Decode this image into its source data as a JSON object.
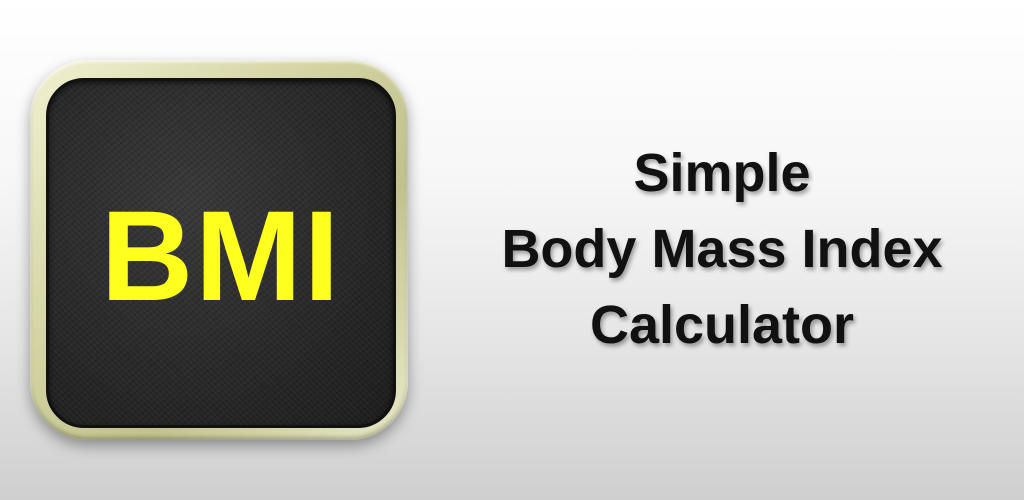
{
  "icon": {
    "label": "BMI",
    "label_color": "#ffff1e",
    "background_color": "#2a2a2a",
    "frame_color": "#d6d6a6"
  },
  "title": {
    "line1": "Simple",
    "line2": "Body Mass Index",
    "line3": "Calculator"
  }
}
